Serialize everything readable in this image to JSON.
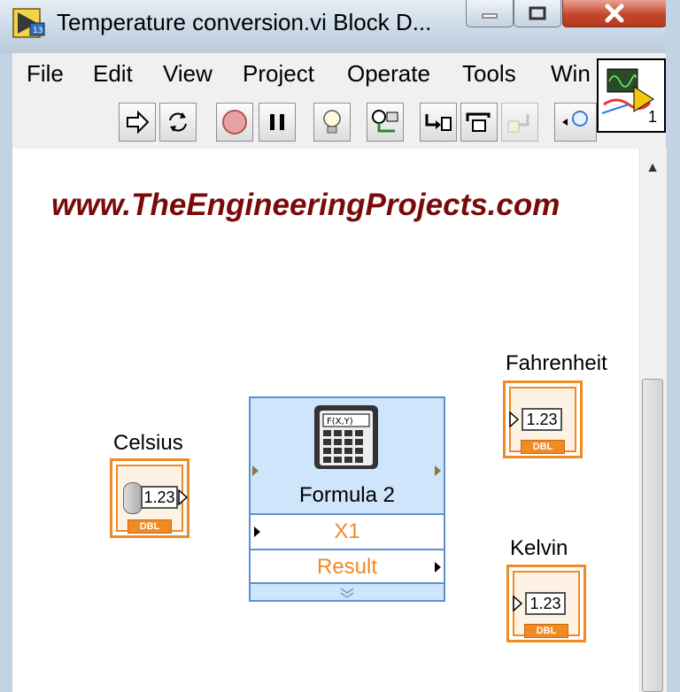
{
  "window": {
    "title": "Temperature conversion.vi Block D...",
    "controls": {
      "minimize": "minimize-icon",
      "maximize": "maximize-icon",
      "close": "close-icon"
    }
  },
  "menu": [
    "File",
    "Edit",
    "View",
    "Project",
    "Operate",
    "Tools",
    "Win"
  ],
  "toolbar": {
    "buttons": [
      "run-arrow-icon",
      "run-continuously-icon",
      "abort-icon",
      "pause-icon",
      "highlight-execution-icon",
      "retain-wire-values-icon",
      "step-into-icon",
      "step-over-icon",
      "step-out-icon",
      "search-icon"
    ]
  },
  "vi_icon": {
    "number": "1"
  },
  "diagram": {
    "watermark": "www.TheEngineeringProjects.com",
    "celsius": {
      "label": "Celsius",
      "value": "1.23",
      "type": "DBL"
    },
    "fahrenheit": {
      "label": "Fahrenheit",
      "value": "1.23",
      "type": "DBL"
    },
    "kelvin": {
      "label": "Kelvin",
      "value": "1.23",
      "type": "DBL"
    },
    "formula": {
      "title": "Formula 2",
      "input": "X1",
      "output": "Result",
      "icon_text": "F(X,Y)"
    }
  },
  "colors": {
    "terminal": "#f08a24",
    "formula_bg": "#cfe5fb",
    "formula_border": "#5d8fd4",
    "watermark": "#7a0a0a"
  }
}
